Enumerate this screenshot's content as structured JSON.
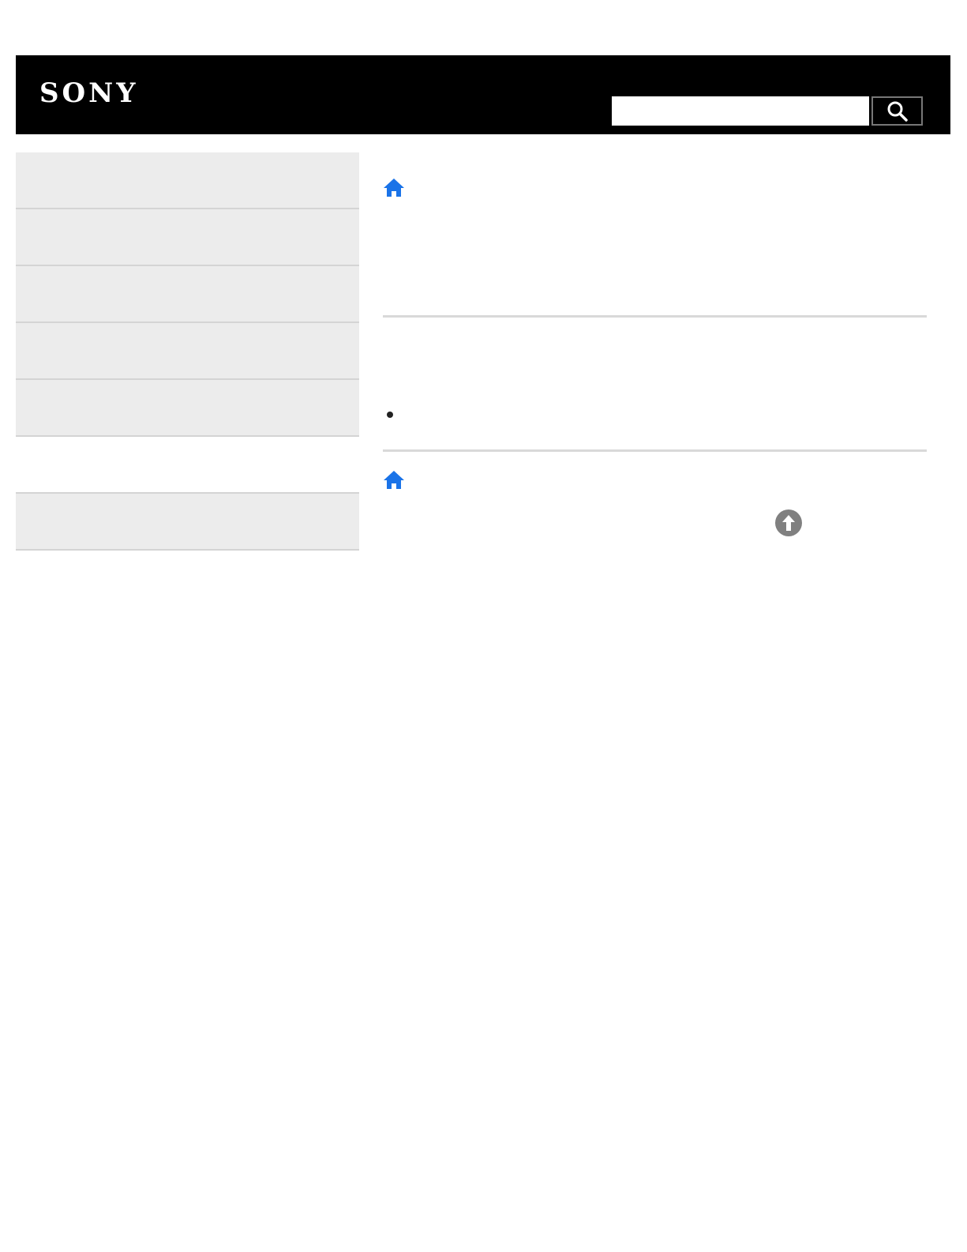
{
  "header": {
    "logo_text": "SONY",
    "background_color": "#000000",
    "search": {
      "placeholder": "",
      "value": "",
      "button_icon": "search-icon"
    }
  },
  "sidebar": {
    "items": [
      {
        "label": ""
      },
      {
        "label": ""
      },
      {
        "label": ""
      },
      {
        "label": ""
      },
      {
        "label": ""
      },
      {
        "label": ""
      },
      {
        "label": ""
      }
    ]
  },
  "main": {
    "home_icon": "home-icon",
    "home_icon_color": "#1a73e8",
    "bullet_items": [
      ""
    ],
    "back_to_top_icon": "arrow-up-circle-icon",
    "back_to_top_color": "#808080"
  }
}
